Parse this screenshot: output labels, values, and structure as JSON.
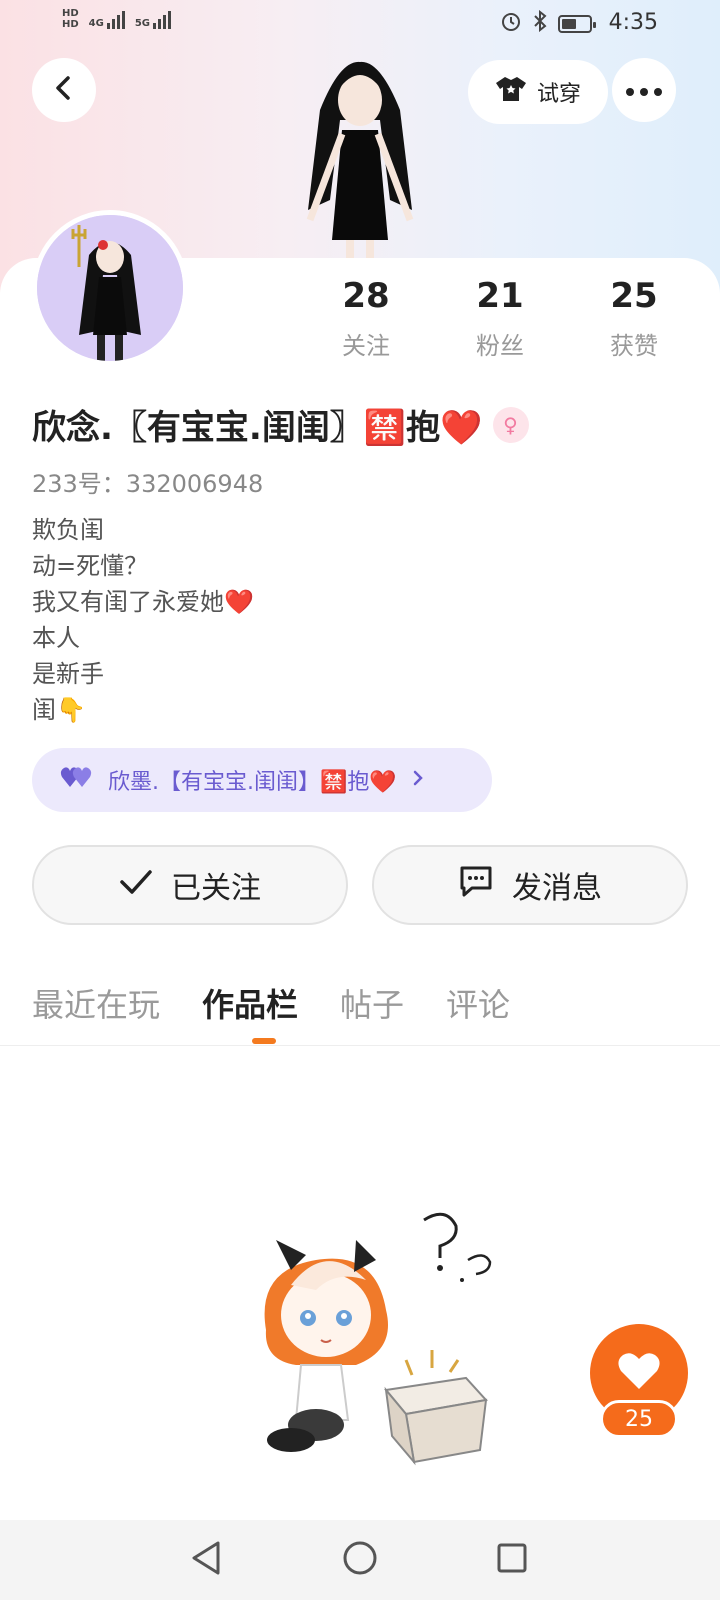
{
  "status_bar": {
    "net_label_1": "HD",
    "net_label_2": "HD",
    "network_4g": "4G",
    "network_5g": "5G",
    "time": "4:35"
  },
  "header": {
    "tryon_label": "试穿"
  },
  "profile": {
    "stats": [
      {
        "value": "28",
        "label": "关注"
      },
      {
        "value": "21",
        "label": "粉丝"
      },
      {
        "value": "25",
        "label": "获赞"
      }
    ],
    "name": "欣念.〖有宝宝.闺闺〗🈲抱❤️",
    "uid": "233号：332006948",
    "bio": [
      "欺负闺",
      "动=死懂？",
      "我又有闺了永爱她❤️",
      "本人",
      "是新手",
      "闺👇"
    ],
    "cp_tag": "欣墨.【有宝宝.闺闺】🈲抱❤️"
  },
  "actions": {
    "follow_label": "已关注",
    "message_label": "发消息"
  },
  "tabs": [
    {
      "label": "最近在玩",
      "active": false
    },
    {
      "label": "作品栏",
      "active": true
    },
    {
      "label": "帖子",
      "active": false
    },
    {
      "label": "评论",
      "active": false
    }
  ],
  "fab": {
    "like_count": "25"
  },
  "colors": {
    "accent": "#f56b1b",
    "tag_bg": "#ece9fc",
    "tag_text": "#6a5bd0"
  }
}
